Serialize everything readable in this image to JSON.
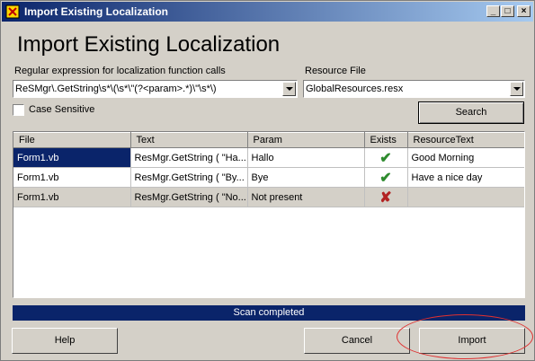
{
  "window": {
    "title": "Import Existing Localization"
  },
  "heading": "Import Existing Localization",
  "regex": {
    "label": "Regular expression for localization function calls",
    "value": "ReSMgr\\.GetString\\s*\\(\\s*\\\"(?<param>.*)\\\"\\s*\\)"
  },
  "resource": {
    "label": "Resource File",
    "value": "GlobalResources.resx"
  },
  "case_sensitive": {
    "label": "Case Sensitive",
    "checked": false
  },
  "search_button": "Search",
  "grid": {
    "columns": [
      "File",
      "Text",
      "Param",
      "Exists",
      "ResourceText"
    ],
    "rows": [
      {
        "file": "Form1.vb",
        "text": "ResMgr.GetString ( \"Ha...",
        "param": "Hallo",
        "exists": "check",
        "resource_text": "Good Morning"
      },
      {
        "file": "Form1.vb",
        "text": "ResMgr.GetString ( \"By...",
        "param": "Bye",
        "exists": "check",
        "resource_text": "Have a nice day"
      },
      {
        "file": "Form1.vb",
        "text": "ResMgr.GetString ( \"No...",
        "param": "Not present",
        "exists": "cross",
        "resource_text": ""
      }
    ]
  },
  "status": "Scan completed",
  "buttons": {
    "help": "Help",
    "cancel": "Cancel",
    "import": "Import"
  },
  "colors": {
    "titlebar": "#0a246a",
    "accent": "#e03030",
    "check": "#2e8b2e",
    "cross": "#b22222"
  }
}
